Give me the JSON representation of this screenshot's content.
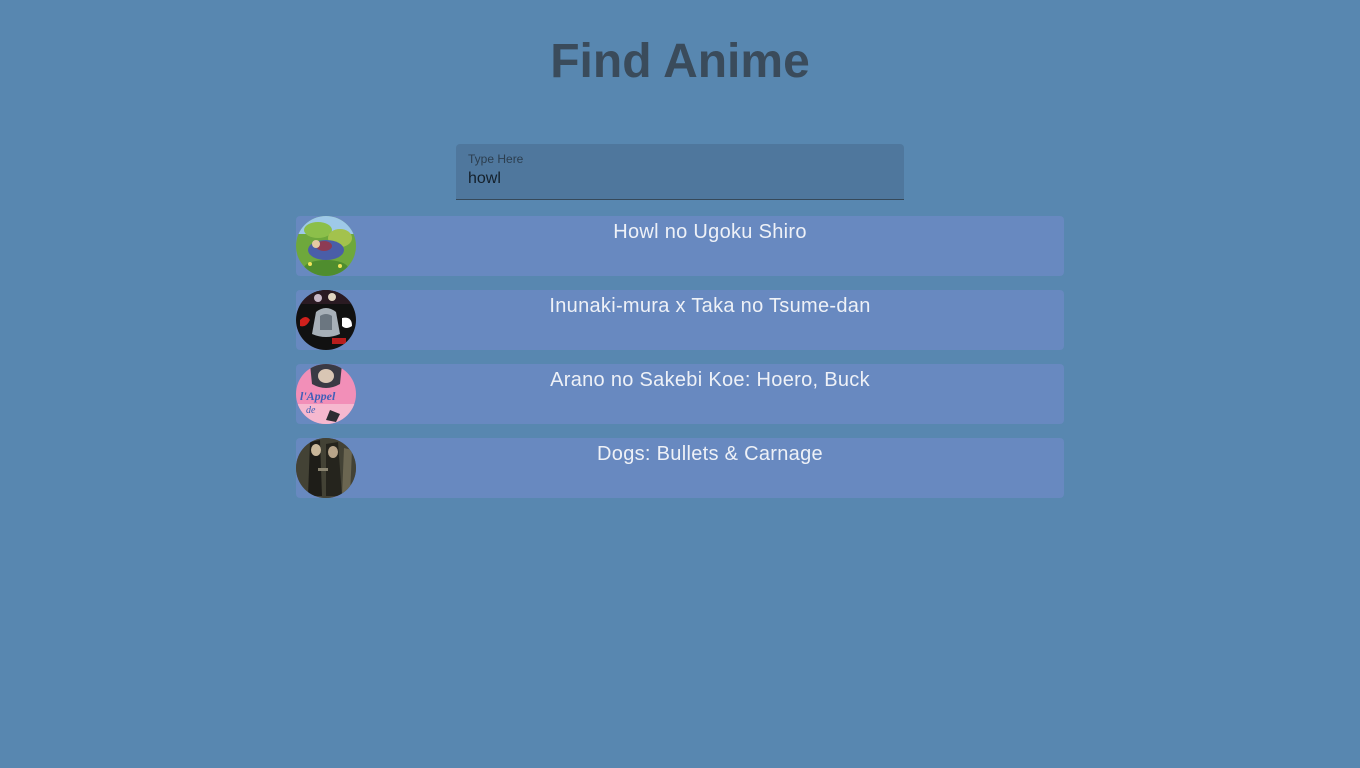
{
  "page": {
    "title": "Find Anime"
  },
  "search": {
    "label": "Type Here",
    "value": "howl"
  },
  "results": [
    {
      "title": "Howl no Ugoku Shiro",
      "thumbnail": "howl-poster-thumbnail"
    },
    {
      "title": "Inunaki-mura x Taka no Tsume-dan",
      "thumbnail": "inunaki-poster-thumbnail"
    },
    {
      "title": "Arano no Sakebi Koe: Hoero, Buck",
      "thumbnail": "arano-poster-thumbnail",
      "poster_text": "l'Appel de"
    },
    {
      "title": "Dogs: Bullets & Carnage",
      "thumbnail": "dogs-poster-thumbnail"
    }
  ],
  "colors": {
    "background": "#5887b0",
    "title": "#3a4b5b",
    "search_field": "#4f779d",
    "result_card": "#6889c0",
    "result_text": "#eef1f7"
  }
}
